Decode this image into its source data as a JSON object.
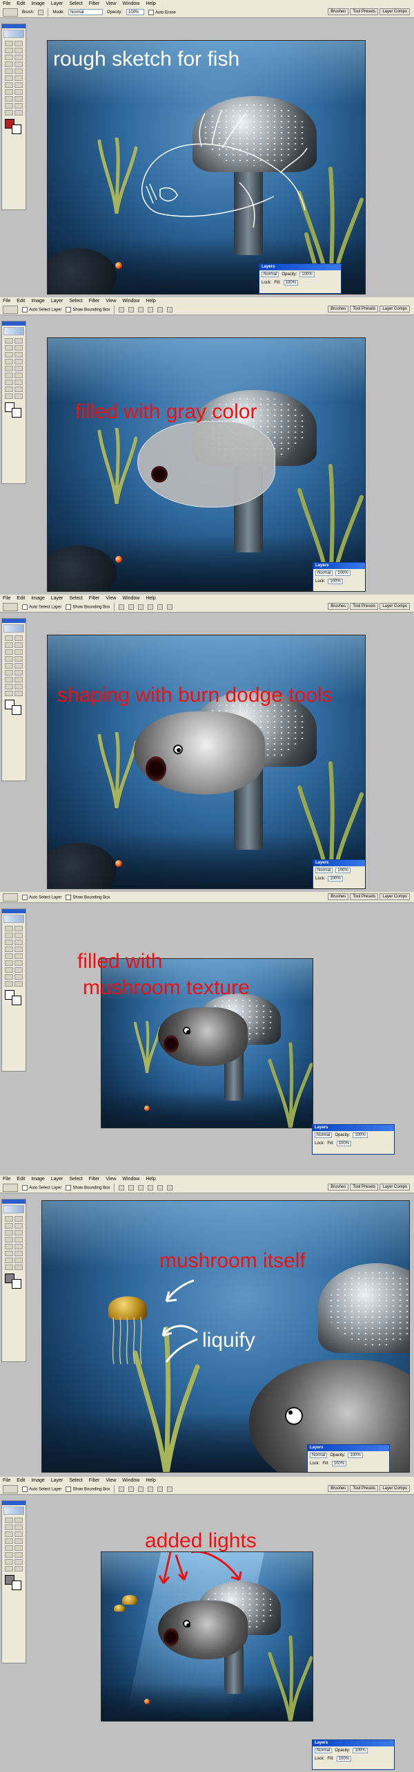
{
  "menu": [
    "File",
    "Edit",
    "Image",
    "Layer",
    "Select",
    "Filter",
    "View",
    "Window",
    "Help"
  ],
  "options_bar_brush": {
    "tool_label": "Brush:",
    "mode_label": "Mode:",
    "mode_value": "Normal",
    "opacity_label": "Opacity:",
    "opacity_value": "100%",
    "auto_erase_label": "Auto Erase"
  },
  "options_bar_move": {
    "auto_select_label": "Auto Select Layer",
    "bounding_box_label": "Show Bounding Box"
  },
  "palette_well": [
    "Brushes",
    "Tool Presets",
    "Layer Comps"
  ],
  "layers_palette": {
    "title": "Layers",
    "blend": "Normal",
    "opacity_label": "Opacity:",
    "opacity_value": "100%",
    "lock_label": "Lock:",
    "fill_label": "Fill:",
    "fill_value": "100%"
  },
  "annotations": {
    "step1": "rough sketch for fish",
    "step2": "filled with gray color",
    "step3": "shaping with burn dodge tools",
    "step4_line1": "filled with",
    "step4_line2": "mushroom texture",
    "step5_a": "mushroom itself",
    "step5_b": "liquify",
    "step6": "added lights"
  },
  "colors": {
    "annotation_red": "#ee1111",
    "annotation_white": "#ffffff",
    "foreground_red": "#b22222"
  }
}
